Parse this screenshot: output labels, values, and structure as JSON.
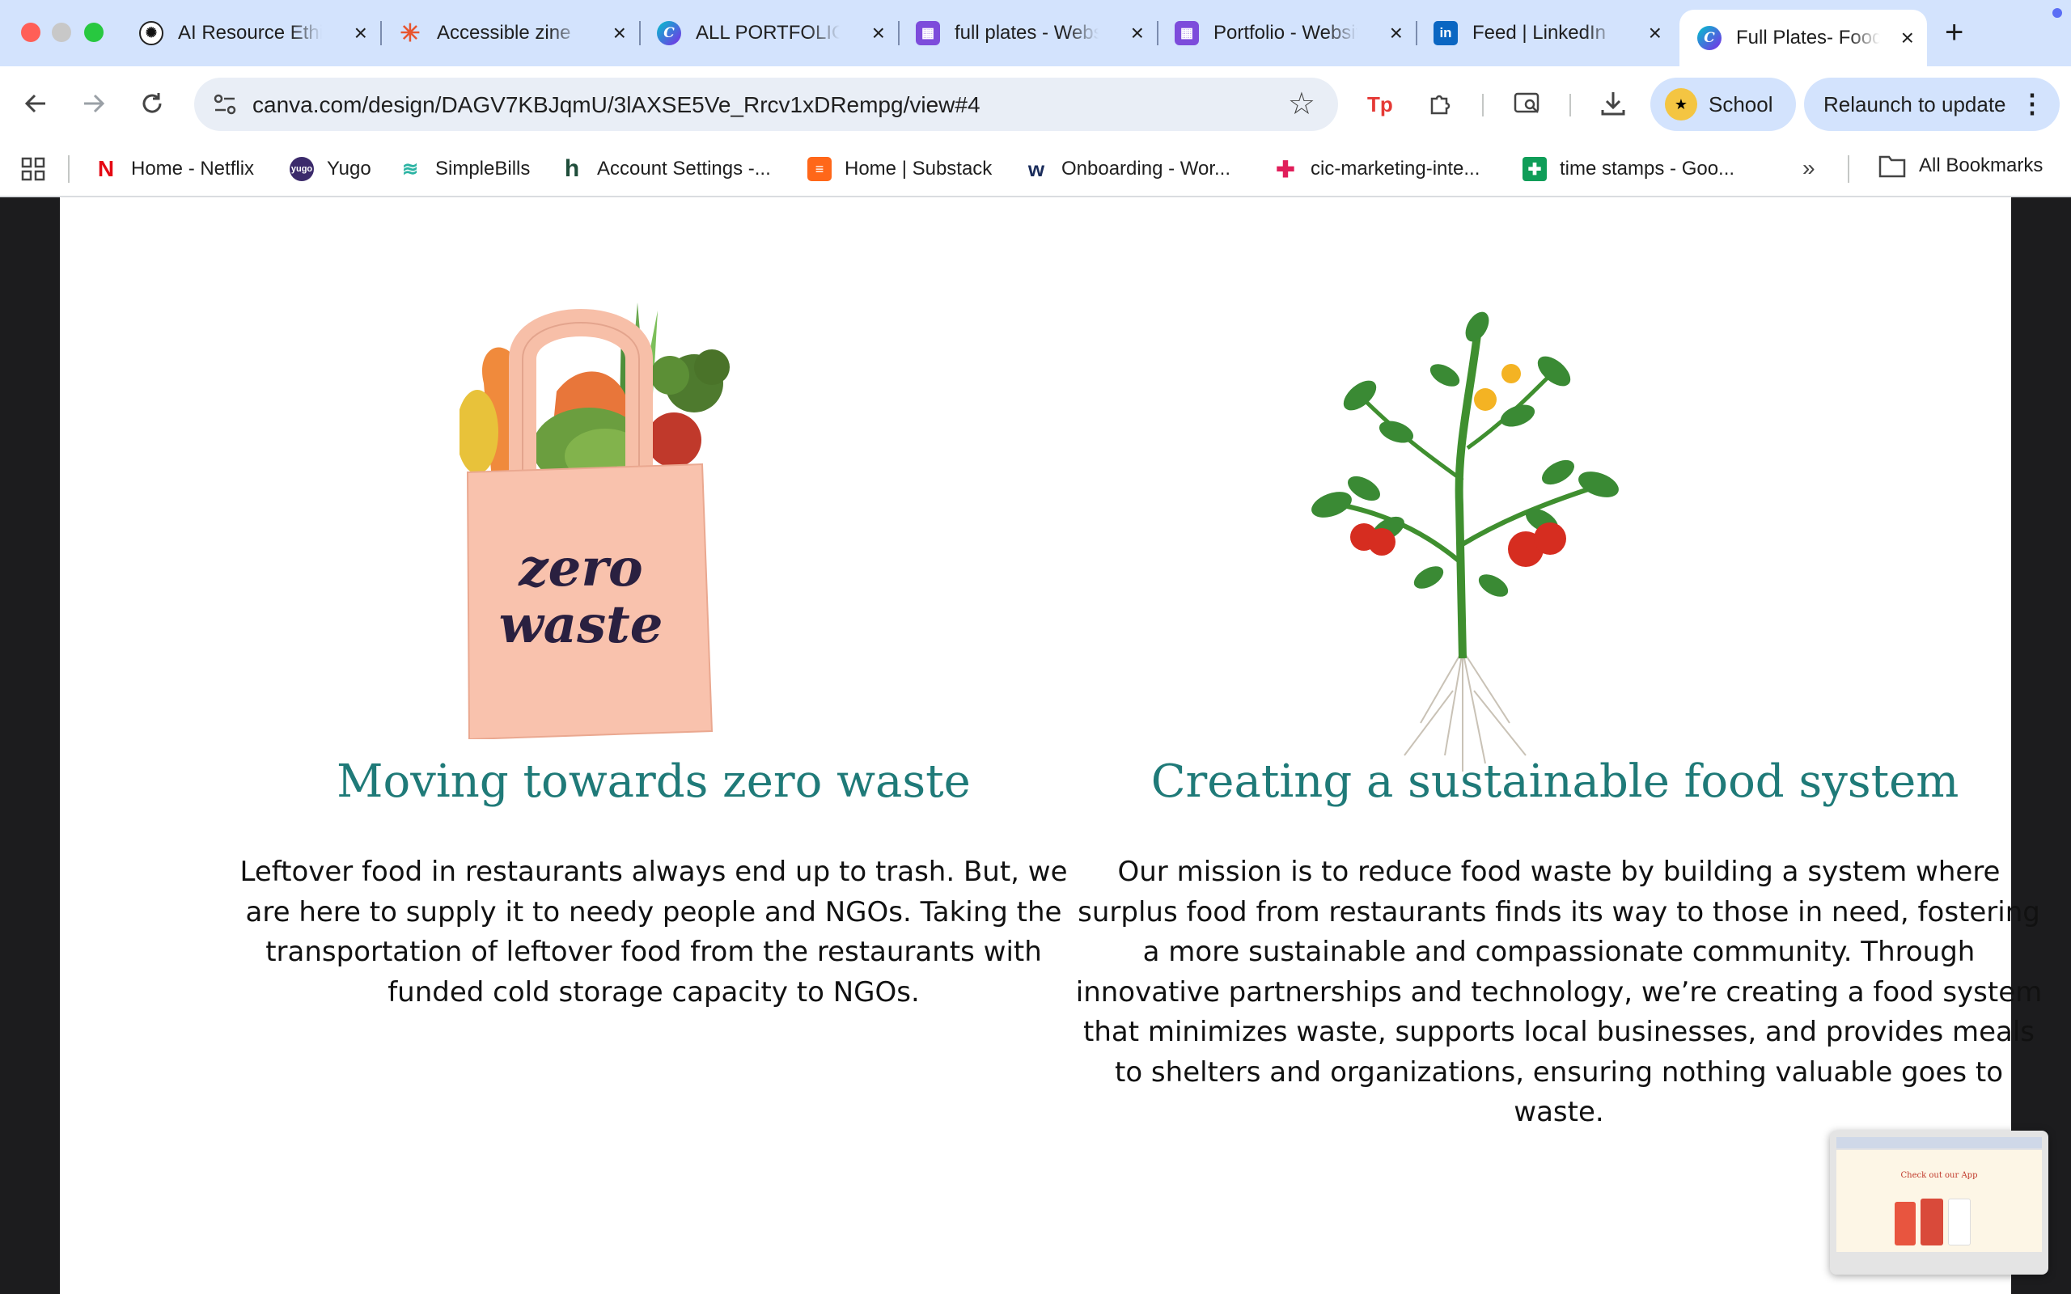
{
  "tabs": [
    {
      "title": "AI Resource Ethics",
      "close": "×"
    },
    {
      "title": "Accessible zine",
      "close": "×"
    },
    {
      "title": "ALL PORTFOLIO",
      "close": "×"
    },
    {
      "title": "full plates - Website",
      "close": "×"
    },
    {
      "title": "Portfolio - Website",
      "close": "×"
    },
    {
      "title": "Feed | LinkedIn",
      "close": "×"
    },
    {
      "title": "Full Plates- Food",
      "close": "×"
    }
  ],
  "new_tab": "+",
  "omnibox": {
    "url": "canva.com/design/DAGV7KBJqmU/3lAXSE5Ve_Rrcv1xDRempg/view#4"
  },
  "profile": {
    "label": "School"
  },
  "relaunch": {
    "label": "Relaunch to update"
  },
  "bookmarks": [
    {
      "label": "Home - Netflix"
    },
    {
      "label": "Yugo"
    },
    {
      "label": "SimpleBills"
    },
    {
      "label": "Account Settings -..."
    },
    {
      "label": "Home | Substack"
    },
    {
      "label": "Onboarding - Wor..."
    },
    {
      "label": "cic-marketing-inte..."
    },
    {
      "label": "time stamps - Goo..."
    }
  ],
  "all_bookmarks": "All Bookmarks",
  "content": {
    "left": {
      "bag_text_line1": "zero",
      "bag_text_line2": "waste",
      "heading": "Moving towards zero waste",
      "body": "Leftover food in restaurants always end up to trash. But, we are here to supply it to needy people and NGOs. Taking the transportation of leftover food from the restaurants with funded cold storage capacity to NGOs."
    },
    "right": {
      "heading": "Creating a sustainable food system",
      "body": "Our mission is to reduce food waste by building a system where surplus food from restaurants finds its way to those in need, fostering a more sustainable and compassionate community. Through innovative partnerships and technology, we’re creating a food system that minimizes waste, supports local businesses, and provides meals to shelters and organizations, ensuring nothing valuable goes to waste."
    }
  },
  "thumbnail": {
    "title": "Check out our App"
  },
  "colors": {
    "accent": "#1f7a78",
    "tab_strip": "#d3e3fd",
    "page_bg": "#ffffff",
    "frame_bg": "#1c1c1e"
  }
}
